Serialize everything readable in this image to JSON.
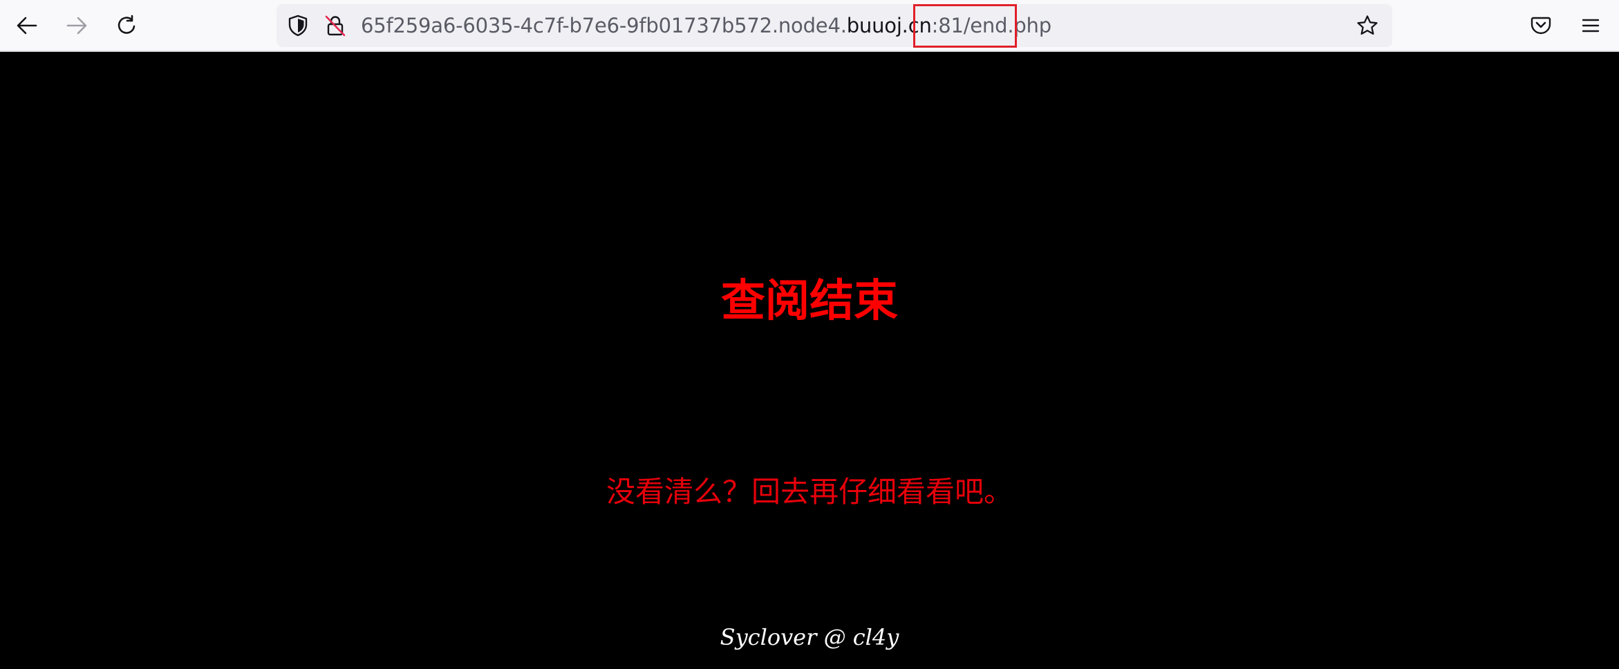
{
  "browser": {
    "url": {
      "prefix": "65f259a6-6035-4c7f-b7e6-9fb01737b572.node4.",
      "host": "buuoj.cn",
      "port": ":81",
      "path": "/end.php"
    },
    "icons": {
      "back": "back-arrow-icon",
      "forward": "forward-arrow-icon",
      "reload": "reload-icon",
      "tracking_protection": "shield-icon",
      "insecure": "insecure-lock-icon",
      "bookmark": "star-icon",
      "pocket": "pocket-icon",
      "menu": "hamburger-menu-icon"
    }
  },
  "page": {
    "heading": "查阅结束",
    "subtext": "没看清么？回去再仔细看看吧。",
    "footer": "Syclover @ cl4y",
    "colors": {
      "background": "#000000",
      "heading": "#ff0000",
      "subtext": "#e5000a",
      "footer": "#ffffff"
    }
  },
  "annotation": {
    "highlight_color": "#e0202a"
  }
}
